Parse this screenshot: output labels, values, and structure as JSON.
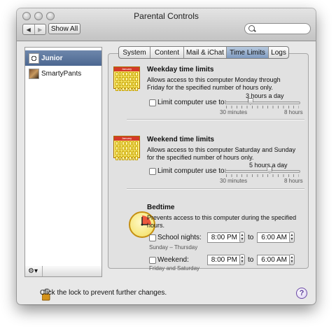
{
  "window": {
    "title": "Parental Controls"
  },
  "toolbar": {
    "back_icon": "◀",
    "forward_icon": "▶",
    "show_all_label": "Show All",
    "search_placeholder": ""
  },
  "sidebar": {
    "accounts": [
      {
        "name": "Junior",
        "selected": true
      },
      {
        "name": "SmartyPants",
        "selected": false
      }
    ],
    "gear_label": "⚙▾"
  },
  "tabs": [
    {
      "label": "System",
      "active": false
    },
    {
      "label": "Content",
      "active": false
    },
    {
      "label": "Mail & iChat",
      "active": false
    },
    {
      "label": "Time Limits",
      "active": true
    },
    {
      "label": "Logs",
      "active": false
    }
  ],
  "weekday": {
    "title": "Weekday time limits",
    "description": "Allows access to this computer Monday through Friday for the specified number of hours only.",
    "checkbox_label": "Limit computer use to:",
    "checked": false,
    "value_text": "3 hours a day",
    "value_hours": 3,
    "min_label": "30 minutes",
    "max_label": "8 hours",
    "calendar_label": "January"
  },
  "weekend": {
    "title": "Weekend time limits",
    "description": "Allows access to this computer Saturday and Sunday for the specified number of hours only.",
    "checkbox_label": "Limit computer use to:",
    "checked": false,
    "value_text": "5 hours a day",
    "value_hours": 5,
    "min_label": "30 minutes",
    "max_label": "8 hours",
    "calendar_label": "January"
  },
  "bedtime": {
    "title": "Bedtime",
    "description": "Prevents access to this computer during the specified hours.",
    "school_nights": {
      "label": "School nights:",
      "sublabel": "Sunday – Thursday",
      "checked": false,
      "from": "8:00 PM",
      "to": "6:00 AM",
      "to_label": "to"
    },
    "weekend": {
      "label": "Weekend:",
      "sublabel": "Friday and Saturday",
      "checked": false,
      "from": "8:00 PM",
      "to": "6:00 AM",
      "to_label": "to"
    }
  },
  "footer": {
    "lock_text": "Click the lock to prevent further changes.",
    "help_label": "?"
  },
  "colors": {
    "selection": "#5672a0",
    "active_tab": "#9fb4d2",
    "calendar_red": "#d43a2a",
    "calendar_yellow": "#f8ea70"
  }
}
